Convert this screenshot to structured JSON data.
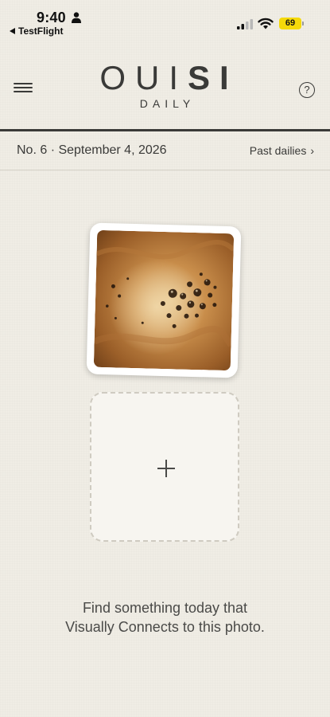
{
  "status_bar": {
    "time": "9:40",
    "back_app": "TestFlight",
    "battery": "69"
  },
  "header": {
    "logo_light": "OUI",
    "logo_bold": "SI",
    "logo_sub": "DAILY"
  },
  "subheader": {
    "issue_date": "No. 6 · September 4, 2026",
    "past_dailies": "Past dailies",
    "chevron": "›"
  },
  "prompt": {
    "line1": "Find something today that",
    "line2": "Visually Connects to this photo."
  },
  "colors": {
    "background": "#f0ede5",
    "text": "#3a3a38",
    "battery": "#f5d90a"
  },
  "icons": {
    "menu": "hamburger-menu-icon",
    "help": "question-circle-icon",
    "add": "plus-icon",
    "forward": "chevron-right-icon"
  }
}
